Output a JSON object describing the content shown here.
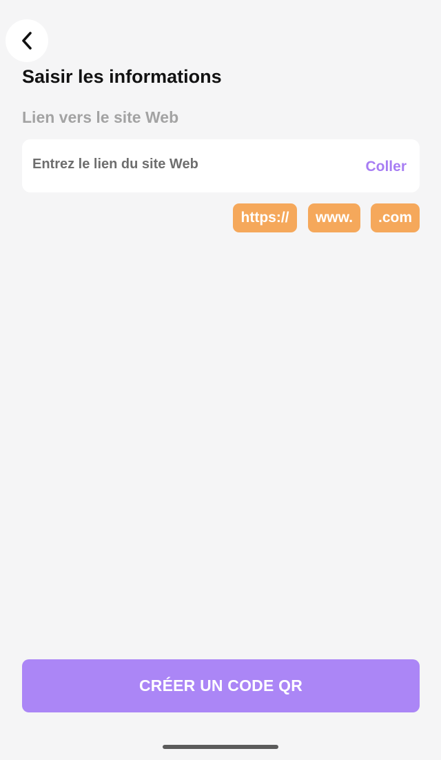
{
  "header": {
    "back_icon": "chevron-left-icon",
    "title": "Saisir les informations"
  },
  "website": {
    "label": "Lien vers le site Web",
    "value": "",
    "placeholder": "Entrez le lien du site Web",
    "paste_label": "Coller"
  },
  "chips": [
    {
      "label": "https://"
    },
    {
      "label": "www."
    },
    {
      "label": ".com"
    }
  ],
  "footer": {
    "create_label": "CRÉER UN CODE QR"
  },
  "colors": {
    "background": "#f5f5f6",
    "accent": "#ab86f6",
    "paste_text": "#a77df3",
    "chip": "#f5a85b"
  }
}
